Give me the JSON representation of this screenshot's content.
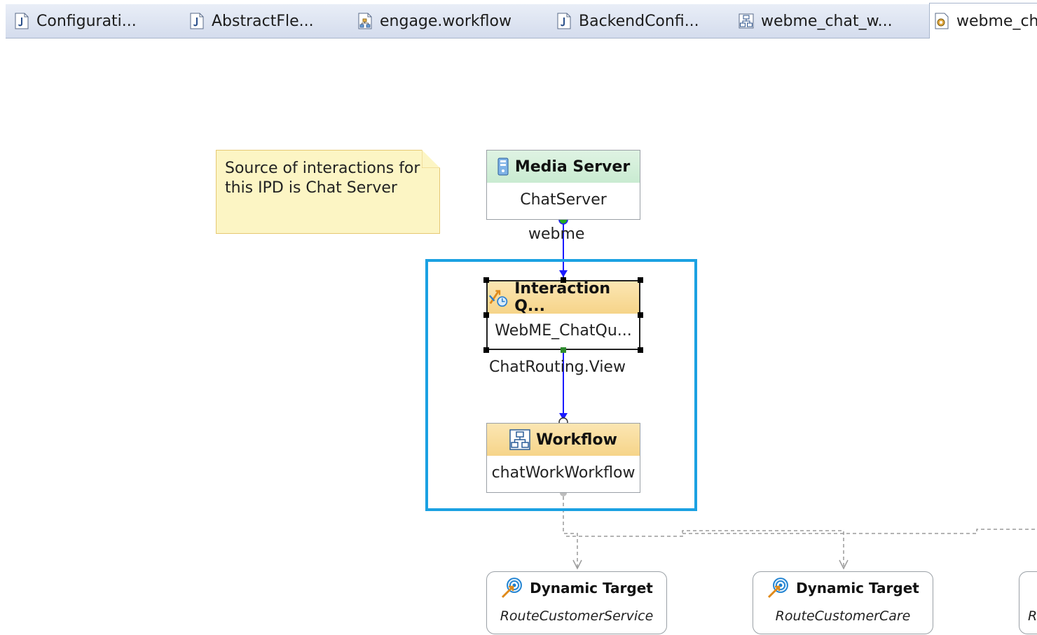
{
  "tabs": [
    {
      "label": "Configurati...",
      "icon": "java-file-icon"
    },
    {
      "label": "AbstractFle...",
      "icon": "java-file-icon"
    },
    {
      "label": "engage.workflow",
      "icon": "workflow-file-icon"
    },
    {
      "label": "BackendConfi...",
      "icon": "java-file-icon"
    },
    {
      "label": "webme_chat_w...",
      "icon": "workflow-diagram-icon"
    },
    {
      "label": "webme_ch",
      "icon": "ipd-diagram-icon",
      "active": true
    }
  ],
  "note": {
    "text": "Source of interactions for this IPD is Chat Server"
  },
  "nodes": {
    "media_server": {
      "title": "Media Server",
      "name": "ChatServer"
    },
    "interaction_queue": {
      "title": "Interaction Q...",
      "name": "WebME_ChatQu..."
    },
    "workflow": {
      "title": "Workflow",
      "name": "chatWorkWorkflow"
    }
  },
  "edges": {
    "media_to_queue": "webme",
    "queue_to_workflow": "ChatRouting.View"
  },
  "targets": [
    {
      "title": "Dynamic Target",
      "name": "RouteCustomerService"
    },
    {
      "title": "Dynamic Target",
      "name": "RouteCustomerCare"
    },
    {
      "title": "",
      "name": "R"
    }
  ],
  "colors": {
    "selection_frame": "#1ba1e2",
    "note_fill": "#fcf5c4",
    "media_header": "#c9ebd1",
    "queue_header": "#f6d489",
    "edge": "#1a1aff"
  }
}
